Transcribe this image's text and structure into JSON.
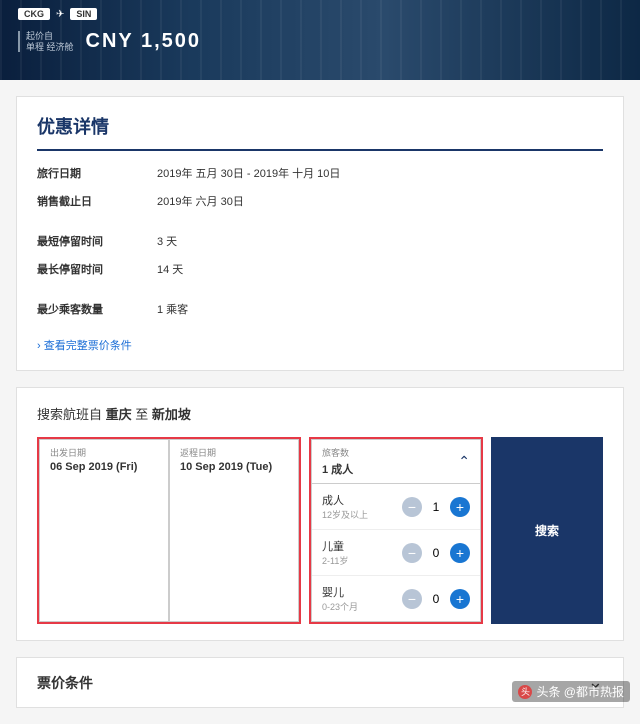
{
  "hero": {
    "origin": "CKG",
    "dest": "SIN",
    "price_prefix": "起价自",
    "price_sub": "单程 经济舱",
    "currency": "CNY",
    "price": "1,500"
  },
  "details": {
    "title": "优惠详情",
    "rows": [
      {
        "label": "旅行日期",
        "value": "2019年 五月 30日 - 2019年 十月 10日"
      },
      {
        "label": "销售截止日",
        "value": "2019年 六月 30日"
      }
    ],
    "rows2": [
      {
        "label": "最短停留时间",
        "value": "3 天"
      },
      {
        "label": "最长停留时间",
        "value": "14 天"
      }
    ],
    "rows3": [
      {
        "label": "最少乘客数量",
        "value": "1 乘客"
      }
    ],
    "link": "› 查看完整票价条件"
  },
  "search": {
    "title_prefix": "搜索航班自 ",
    "from": "重庆",
    "mid": " 至 ",
    "to": "新加坡",
    "depart_label": "出发日期",
    "depart_value": "06 Sep 2019 (Fri)",
    "return_label": "返程日期",
    "return_value": "10 Sep 2019 (Tue)",
    "pax_label": "旅客数",
    "pax_value": "1 成人",
    "button": "搜索",
    "passengers": [
      {
        "name": "成人",
        "sub": "12岁及以上",
        "count": "1"
      },
      {
        "name": "儿童",
        "sub": "2-11岁",
        "count": "0"
      },
      {
        "name": "婴儿",
        "sub": "0-23个月",
        "count": "0"
      }
    ]
  },
  "fare": {
    "title": "票价条件"
  },
  "watermark": "头条 @都市热报"
}
